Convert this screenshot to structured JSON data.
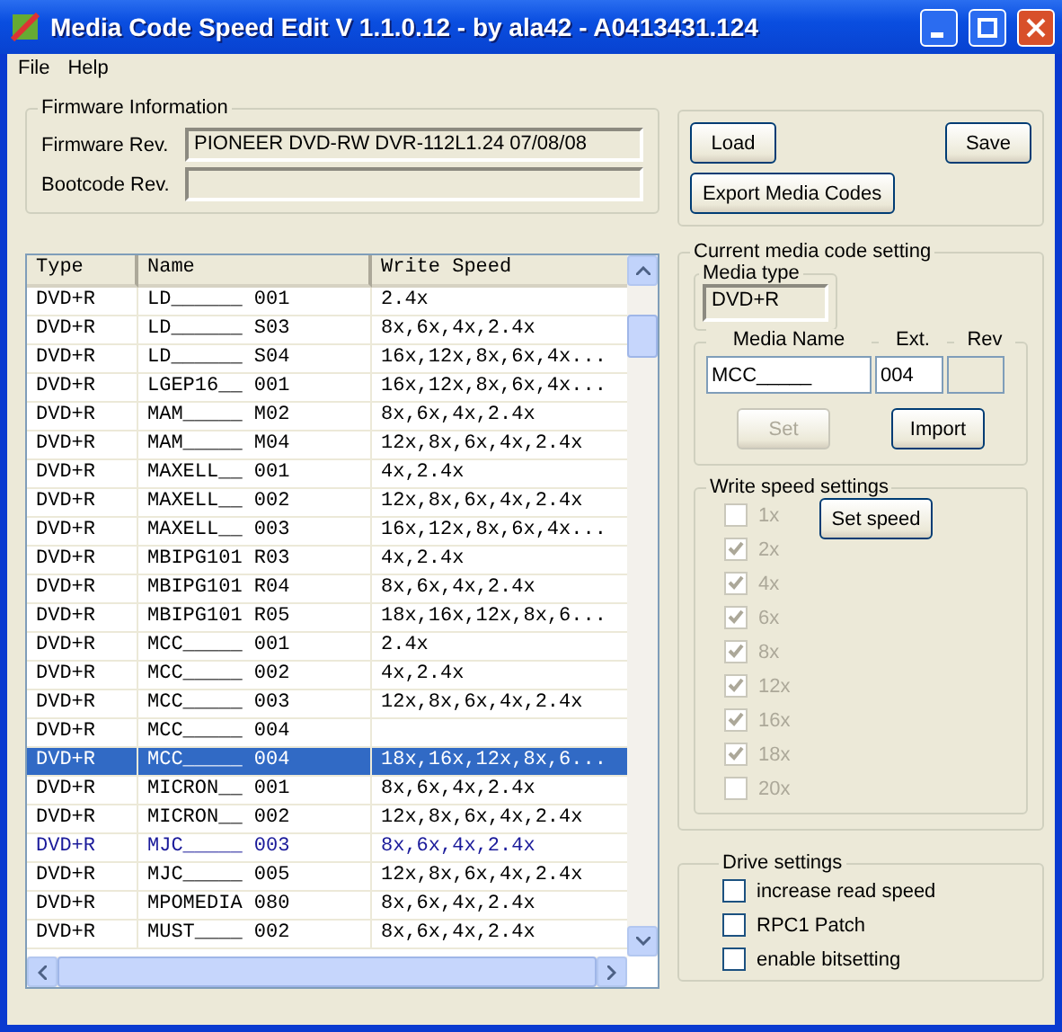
{
  "window": {
    "title": "Media Code Speed Edit V 1.1.0.12 - by ala42 - A0413431.124"
  },
  "menu": [
    "File",
    "Help"
  ],
  "firmware": {
    "title": "Firmware Information",
    "fields": [
      {
        "label": "Firmware Rev.",
        "value": "PIONEER DVD-RW  DVR-112L1.24 07/08/08"
      },
      {
        "label": "Bootcode Rev."
      }
    ]
  },
  "file_buttons": [
    "Load",
    "Save",
    "Export Media Codes"
  ],
  "table": {
    "columns": [
      "Type",
      "Name",
      "Write Speed"
    ],
    "rows": [
      {
        "cells": [
          "DVD+R",
          "LD______ 001",
          "2.4x"
        ],
        "selected": false,
        "highlighted": false
      },
      {
        "cells": [
          "DVD+R",
          "LD______ S03",
          "8x,6x,4x,2.4x"
        ],
        "selected": false,
        "highlighted": false
      },
      {
        "cells": [
          "DVD+R",
          "LD______ S04",
          "16x,12x,8x,6x,4x..."
        ],
        "selected": false,
        "highlighted": false
      },
      {
        "cells": [
          "DVD+R",
          "LGEP16__ 001",
          "16x,12x,8x,6x,4x..."
        ],
        "selected": false,
        "highlighted": false
      },
      {
        "cells": [
          "DVD+R",
          "MAM_____ M02",
          "8x,6x,4x,2.4x"
        ],
        "selected": false,
        "highlighted": false
      },
      {
        "cells": [
          "DVD+R",
          "MAM_____ M04",
          "12x,8x,6x,4x,2.4x"
        ],
        "selected": false,
        "highlighted": false
      },
      {
        "cells": [
          "DVD+R",
          "MAXELL__ 001",
          "4x,2.4x"
        ],
        "selected": false,
        "highlighted": false
      },
      {
        "cells": [
          "DVD+R",
          "MAXELL__ 002",
          "12x,8x,6x,4x,2.4x"
        ],
        "selected": false,
        "highlighted": false
      },
      {
        "cells": [
          "DVD+R",
          "MAXELL__ 003",
          "16x,12x,8x,6x,4x..."
        ],
        "selected": false,
        "highlighted": false
      },
      {
        "cells": [
          "DVD+R",
          "MBIPG101 R03",
          "4x,2.4x"
        ],
        "selected": false,
        "highlighted": false
      },
      {
        "cells": [
          "DVD+R",
          "MBIPG101 R04",
          "8x,6x,4x,2.4x"
        ],
        "selected": false,
        "highlighted": false
      },
      {
        "cells": [
          "DVD+R",
          "MBIPG101 R05",
          "18x,16x,12x,8x,6..."
        ],
        "selected": false,
        "highlighted": false
      },
      {
        "cells": [
          "DVD+R",
          "MCC_____ 001",
          "2.4x"
        ],
        "selected": false,
        "highlighted": false
      },
      {
        "cells": [
          "DVD+R",
          "MCC_____ 002",
          "4x,2.4x"
        ],
        "selected": false,
        "highlighted": false
      },
      {
        "cells": [
          "DVD+R",
          "MCC_____ 003",
          "12x,8x,6x,4x,2.4x"
        ],
        "selected": false,
        "highlighted": false
      },
      {
        "cells": [
          "DVD+R",
          "MCC_____ 004"
        ],
        "selected": false,
        "highlighted": false
      },
      {
        "cells": [
          "DVD+R",
          "MCC_____ 004",
          "18x,16x,12x,8x,6..."
        ],
        "selected": true,
        "highlighted": false
      },
      {
        "cells": [
          "DVD+R",
          "MICRON__ 001",
          "8x,6x,4x,2.4x"
        ],
        "selected": false,
        "highlighted": false
      },
      {
        "cells": [
          "DVD+R",
          "MICRON__ 002",
          "12x,8x,6x,4x,2.4x"
        ],
        "selected": false,
        "highlighted": false
      },
      {
        "cells": [
          "DVD+R",
          "MJC_____ 003",
          "8x,6x,4x,2.4x"
        ],
        "selected": false,
        "highlighted": true
      },
      {
        "cells": [
          "DVD+R",
          "MJC_____ 005",
          "12x,8x,6x,4x,2.4x"
        ],
        "selected": false,
        "highlighted": false
      },
      {
        "cells": [
          "DVD+R",
          "MPOMEDIA 080",
          "8x,6x,4x,2.4x"
        ],
        "selected": false,
        "highlighted": false
      },
      {
        "cells": [
          "DVD+R",
          "MUST____ 002",
          "8x,6x,4x,2.4x"
        ],
        "selected": false,
        "highlighted": false
      }
    ]
  },
  "current": {
    "title": "Current media code setting",
    "media_type": {
      "title": "Media type",
      "value": "DVD+R"
    },
    "name_labels": [
      "Media Name",
      "Ext.",
      "Rev"
    ],
    "name_value": "MCC_____",
    "ext_value": "004",
    "buttons": [
      {
        "label": "Set",
        "disabled": true
      },
      {
        "label": "Import",
        "disabled": false
      }
    ]
  },
  "write_speed": {
    "title": "Write speed settings",
    "button": "Set speed",
    "speeds": [
      {
        "label": "1x",
        "checked": false,
        "disabled": true
      },
      {
        "label": "2x",
        "checked": true,
        "disabled": true
      },
      {
        "label": "4x",
        "checked": true,
        "disabled": true
      },
      {
        "label": "6x",
        "checked": true,
        "disabled": true
      },
      {
        "label": "8x",
        "checked": true,
        "disabled": true
      },
      {
        "label": "12x",
        "checked": true,
        "disabled": true
      },
      {
        "label": "16x",
        "checked": true,
        "disabled": true
      },
      {
        "label": "18x",
        "checked": true,
        "disabled": true
      },
      {
        "label": "20x",
        "checked": false,
        "disabled": true
      }
    ]
  },
  "drive": {
    "title": "Drive settings",
    "options": [
      {
        "label": "increase read speed",
        "checked": false,
        "disabled": false
      },
      {
        "label": "RPC1 Patch",
        "checked": false,
        "disabled": false
      },
      {
        "label": "enable bitsetting",
        "checked": false,
        "disabled": false
      }
    ]
  }
}
